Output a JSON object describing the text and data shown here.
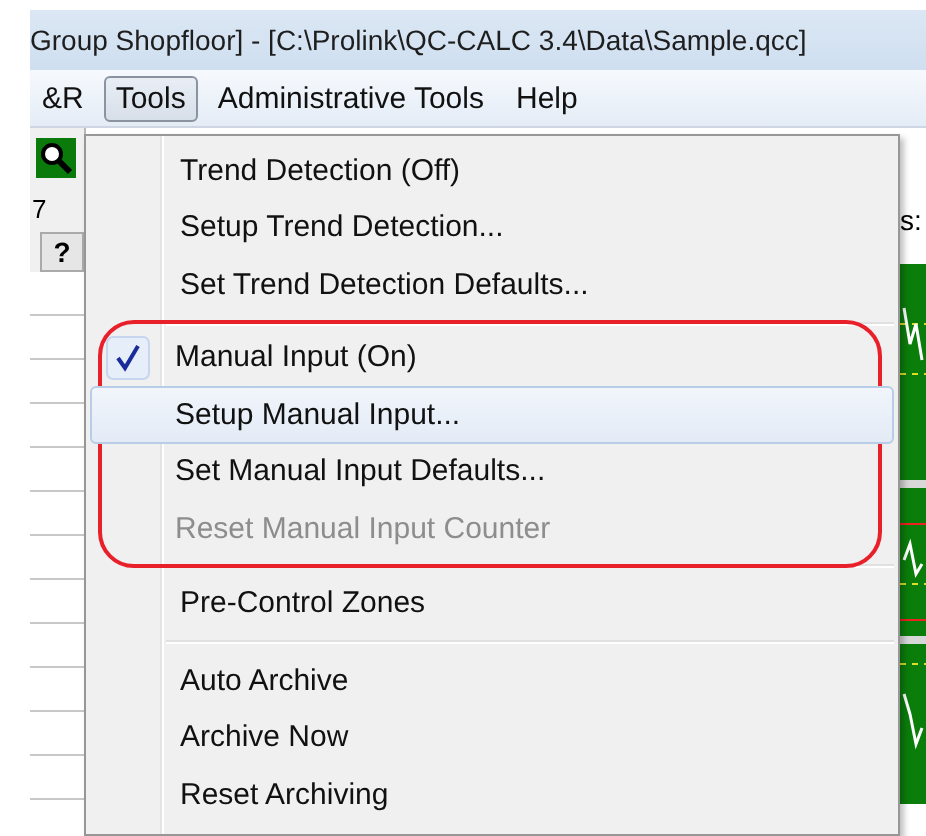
{
  "window": {
    "title": "Group Shopfloor] - [C:\\Prolink\\QC-CALC 3.4\\Data\\Sample.qcc]"
  },
  "menu_bar": [
    {
      "label": "&R",
      "selected": false
    },
    {
      "label": "Tools",
      "selected": true
    },
    {
      "label": "Administrative Tools",
      "selected": false
    },
    {
      "label": "Help",
      "selected": false
    }
  ],
  "background_window": {
    "column_text": "7",
    "help_key": "?",
    "label_text": "s:"
  },
  "tools_menu": {
    "items": [
      {
        "kind": "item",
        "label": "Trend Detection (Off)",
        "checked": false,
        "highlighted": false,
        "disabled": false
      },
      {
        "kind": "item",
        "label": "Setup Trend Detection...",
        "checked": false,
        "highlighted": false,
        "disabled": false
      },
      {
        "kind": "item",
        "label": "Set Trend Detection Defaults...",
        "checked": false,
        "highlighted": false,
        "disabled": false
      },
      {
        "kind": "separator"
      },
      {
        "kind": "circled_group",
        "items": [
          {
            "kind": "item",
            "label": "Manual Input (On)",
            "checked": true,
            "highlighted": false,
            "disabled": false
          },
          {
            "kind": "item",
            "label": "Setup Manual Input...",
            "checked": false,
            "highlighted": true,
            "disabled": false
          },
          {
            "kind": "item",
            "label": "Set Manual Input Defaults...",
            "checked": false,
            "highlighted": false,
            "disabled": false
          },
          {
            "kind": "item",
            "label": "Reset Manual Input Counter",
            "checked": false,
            "highlighted": false,
            "disabled": true
          }
        ]
      },
      {
        "kind": "separator"
      },
      {
        "kind": "item",
        "label": "Pre-Control Zones",
        "checked": false,
        "highlighted": false,
        "disabled": false
      },
      {
        "kind": "separator"
      },
      {
        "kind": "item",
        "label": "Auto Archive",
        "checked": false,
        "highlighted": false,
        "disabled": false
      },
      {
        "kind": "item",
        "label": "Archive Now",
        "checked": false,
        "highlighted": false,
        "disabled": false
      },
      {
        "kind": "item",
        "label": "Reset Archiving",
        "checked": false,
        "highlighted": false,
        "disabled": false
      }
    ]
  }
}
